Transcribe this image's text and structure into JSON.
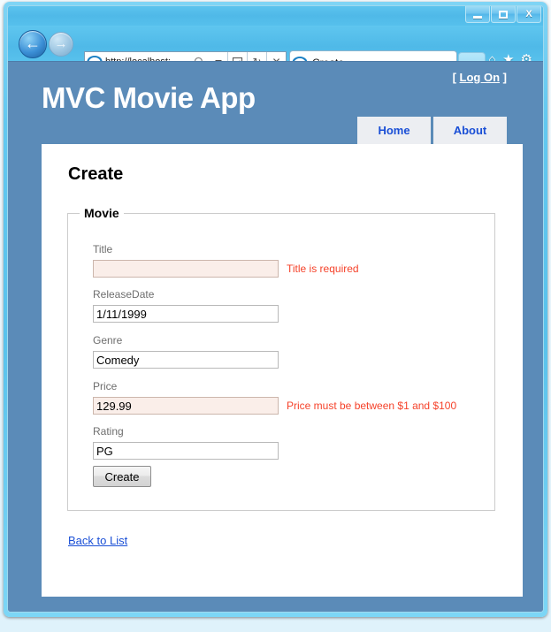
{
  "window": {
    "minimize_label": "Minimize",
    "maximize_label": "Maximize",
    "close_label": "X"
  },
  "browser": {
    "back_glyph": "←",
    "forward_glyph": "→",
    "url": "http://localhost:",
    "search_glyph": "⚲",
    "dropdown_glyph": "▾",
    "compat_glyph": "⌸",
    "refresh_glyph": "↻",
    "stop_glyph": "✕",
    "tab_title": "Create",
    "home_glyph": "⌂",
    "favorites_glyph": "★",
    "tools_glyph": "⚙"
  },
  "page": {
    "logon_open_bracket": "[",
    "logon_label": "Log On",
    "logon_close_bracket": "]",
    "site_title": "MVC Movie App",
    "nav": [
      {
        "label": "Home"
      },
      {
        "label": "About"
      }
    ],
    "title": "Create",
    "fieldset_legend": "Movie",
    "fields": [
      {
        "label": "Title",
        "value": "",
        "error": "Title is required",
        "has_error": true
      },
      {
        "label": "ReleaseDate",
        "value": "1/11/1999",
        "error": "",
        "has_error": false
      },
      {
        "label": "Genre",
        "value": "Comedy",
        "error": "",
        "has_error": false
      },
      {
        "label": "Price",
        "value": "129.99",
        "error": "Price must be between $1 and $100",
        "has_error": true
      },
      {
        "label": "Rating",
        "value": "PG",
        "error": "",
        "has_error": false
      }
    ],
    "submit_label": "Create",
    "back_link_label": "Back to List"
  },
  "colors": {
    "page_background": "#5b8bb8",
    "content_background": "#ffffff",
    "link": "#1a4fd6",
    "error_text": "#f5422a",
    "error_field_background": "#faeee9",
    "label_text": "#6e6e6e",
    "nav_tab_background": "#eceef2"
  }
}
